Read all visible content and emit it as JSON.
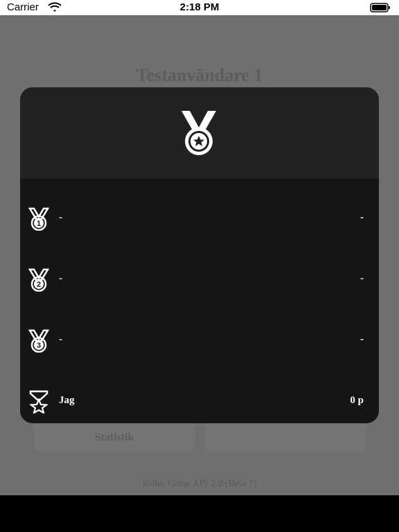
{
  "status_bar": {
    "carrier": "Carrier",
    "time": "2:18 PM"
  },
  "background": {
    "title": "Testanvändare 1",
    "statistics_button": "Statistik",
    "right_button": "",
    "footer": "Killer Game API 2.0 (Beta 7)"
  },
  "leaderboard": {
    "header_icon": "medal-star-icon",
    "rows": [
      {
        "rank_icon": "medal-1-icon",
        "name": "-",
        "points": "-"
      },
      {
        "rank_icon": "medal-2-icon",
        "name": "-",
        "points": "-"
      },
      {
        "rank_icon": "medal-3-icon",
        "name": "-",
        "points": "-"
      },
      {
        "rank_icon": "hourglass-star-icon",
        "name": "Jag",
        "points": "0 p"
      }
    ]
  },
  "colors": {
    "backdrop": "#6f6f6f",
    "modal_header": "#222222",
    "modal_body": "#151515",
    "text": "#ffffff"
  }
}
